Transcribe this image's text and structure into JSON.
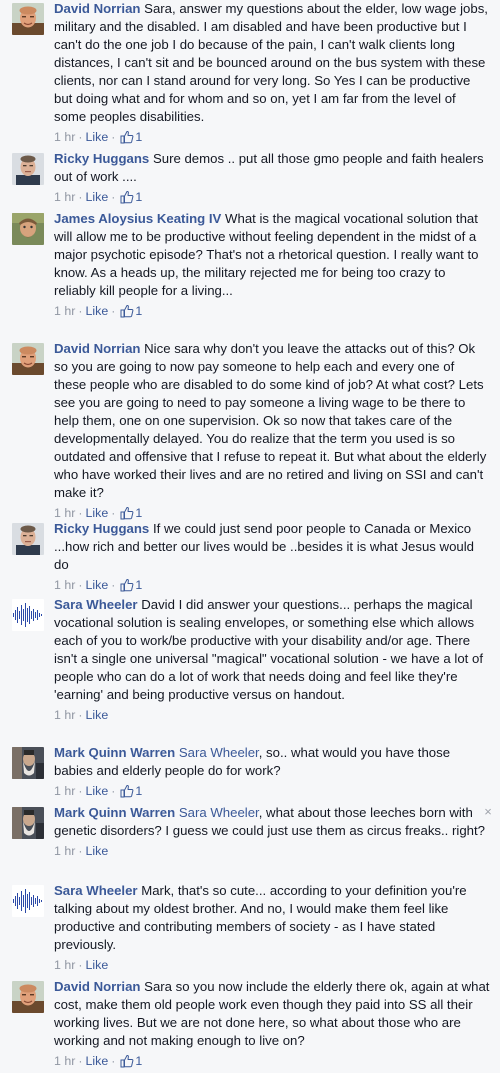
{
  "comments": [
    {
      "author": "David Norrian",
      "mention": "",
      "text": "Sara, answer my questions about the elder, low wage jobs, military and the disabled. I am disabled and have been productive but I can't do the one job I do because of the pain, I can't walk clients long distances, I can't sit and be bounced around on the bus system with these clients, nor can I stand around for very long. So Yes I can be productive but doing what and for whom and so on, yet I am far from the level of some peoples disabilities.",
      "time": "1 hr",
      "like_label": "Like",
      "likes": "1",
      "avatar": "david"
    },
    {
      "author": "Ricky Huggans",
      "mention": "",
      "text": "Sure demos .. put all those gmo people and faith healers out of work ....",
      "time": "1 hr",
      "like_label": "Like",
      "likes": "1",
      "avatar": "ricky"
    },
    {
      "author": "James Aloysius Keating IV",
      "mention": "",
      "text": "What is the magical vocational solution that will allow me to be productive without feeling dependent in the midst of a major psychotic episode? That's not a rhetorical question. I really want to know. As a heads up, the military rejected me for being too crazy to reliably kill people for a living...",
      "time": "1 hr",
      "like_label": "Like",
      "likes": "1",
      "avatar": "james"
    },
    {
      "author": "David Norrian",
      "mention": "",
      "text": "Nice sara why don't you leave the attacks out of this? Ok so you are going to now pay someone to help each and every one of these people who are disabled to do some kind of job? At what cost? Lets see you are going to need to pay someone a living wage to be there to help them, one on one supervision. Ok so now that takes care of the developmentally delayed. You do realize that the term you used is so outdated and offensive that I refuse to repeat it. But what about the elderly who have worked their lives and are no retired and living on SSI and can't make it?",
      "time": "1 hr",
      "like_label": "Like",
      "likes": "1",
      "avatar": "david"
    },
    {
      "author": "Ricky Huggans",
      "mention": "",
      "text": "If we could just send poor people to Canada or Mexico ...how rich and better our lives would be ..besides it is what Jesus would do",
      "time": "1 hr",
      "like_label": "Like",
      "likes": "1",
      "avatar": "ricky"
    },
    {
      "author": "Sara Wheeler",
      "mention": "",
      "text": "David I did answer your questions... perhaps the magical vocational solution is sealing envelopes, or something else which allows each of you to work/be productive with your disability and/or age. There isn't a single one universal \"magical\" vocational solution - we have a lot of people who can do a lot of work that needs doing and feel like they're 'earning' and being productive versus on handout.",
      "time": "1 hr",
      "like_label": "Like",
      "likes": "",
      "avatar": "sara"
    },
    {
      "author": "Mark Quinn Warren",
      "mention": "Sara Wheeler",
      "text": ", so.. what would you have those babies and elderly people do for work?",
      "time": "1 hr",
      "like_label": "Like",
      "likes": "1",
      "avatar": "mark"
    },
    {
      "author": "Mark Quinn Warren",
      "mention": "Sara Wheeler",
      "text": ", what about those leeches born with genetic disorders? I guess we could just use them as circus freaks.. right?",
      "time": "1 hr",
      "like_label": "Like",
      "likes": "",
      "avatar": "mark",
      "remove": "×"
    },
    {
      "author": "Sara Wheeler",
      "mention": "",
      "text": "Mark, that's so cute... according to your definition you're talking about my oldest brother. And no, I would make them feel like productive and contributing members of society - as I have stated previously.",
      "time": "1 hr",
      "like_label": "Like",
      "likes": "",
      "avatar": "sara"
    },
    {
      "author": "David Norrian",
      "mention": "",
      "text": "Sara so you now include the elderly there ok, again at what cost, make them old people work even though they paid into SS all their working lives. But we are not done here, so what about those who are working and not making enough to live on?",
      "time": "1 hr",
      "like_label": "Like",
      "likes": "1",
      "avatar": "david"
    }
  ],
  "colors": {
    "link": "#3b5998",
    "meta": "#9197a3",
    "text": "#141823",
    "background": "#f6f7f9"
  },
  "icons": {
    "like_count": "thumbs-up-icon",
    "remove": "close-icon"
  }
}
